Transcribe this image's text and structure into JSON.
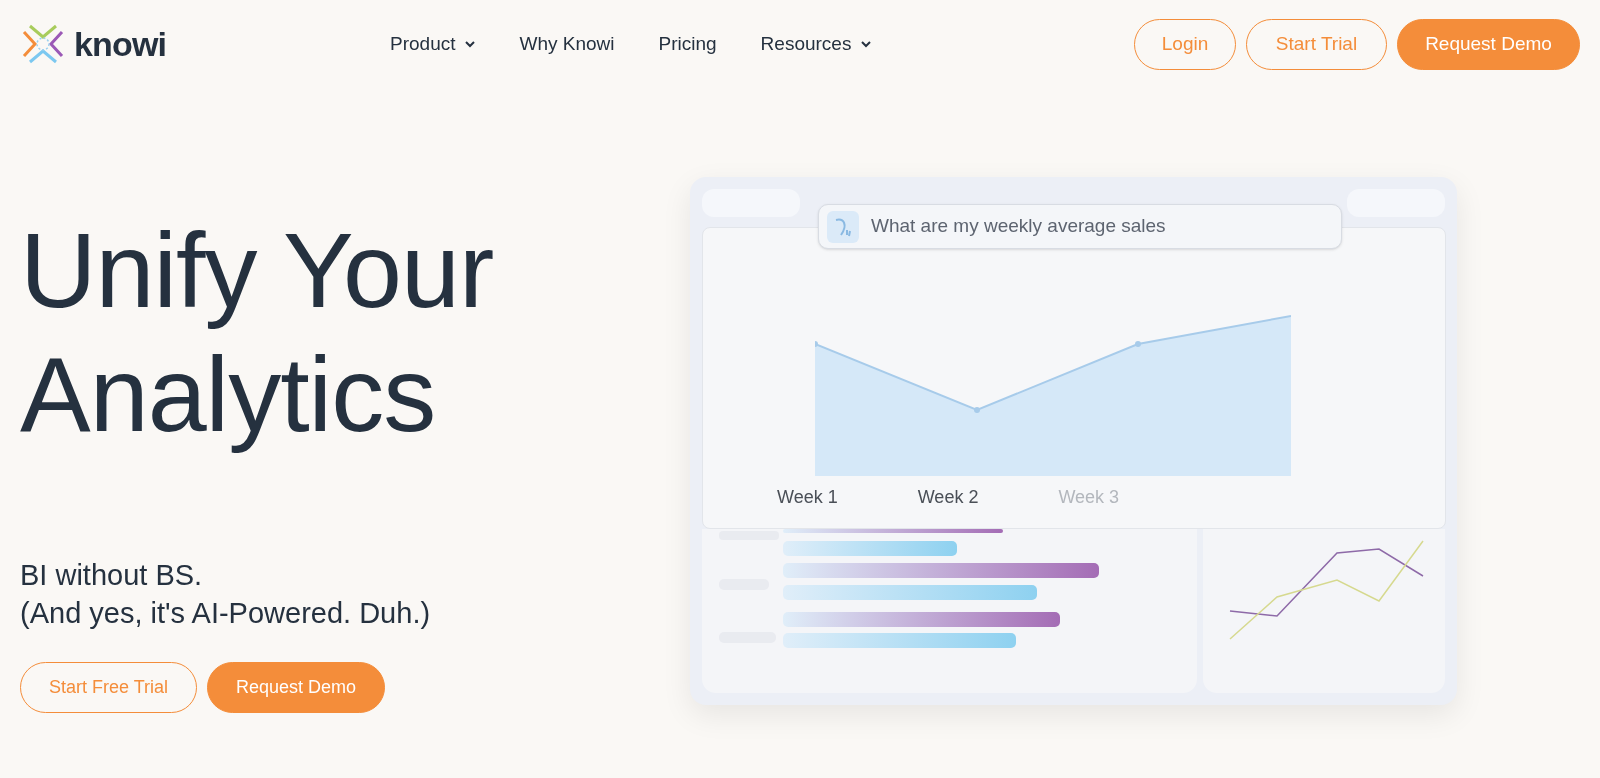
{
  "brand": {
    "name": "knowi"
  },
  "nav": [
    {
      "label": "Product",
      "has_menu": true
    },
    {
      "label": "Why Knowi",
      "has_menu": false
    },
    {
      "label": "Pricing",
      "has_menu": false
    },
    {
      "label": "Resources",
      "has_menu": true
    }
  ],
  "header_buttons": [
    {
      "label": "Login",
      "kind": "outline"
    },
    {
      "label": "Start Trial",
      "kind": "outline"
    },
    {
      "label": "Request Demo",
      "kind": "filled"
    }
  ],
  "hero": {
    "headline": [
      "Unify Your",
      "Analytics"
    ],
    "subtitle": [
      "BI without BS.",
      "(And yes, it's AI-Powered. Duh.)"
    ],
    "buttons": [
      {
        "label": "Start Free Trial",
        "kind": "outline"
      },
      {
        "label": "Request Demo",
        "kind": "filled"
      }
    ]
  },
  "illustration": {
    "query": "What are my weekly average sales",
    "weeks": [
      {
        "label": "Week 1",
        "faded": false
      },
      {
        "label": "Week 2",
        "faded": false
      },
      {
        "label": "Week 3",
        "faded": true
      }
    ]
  }
}
